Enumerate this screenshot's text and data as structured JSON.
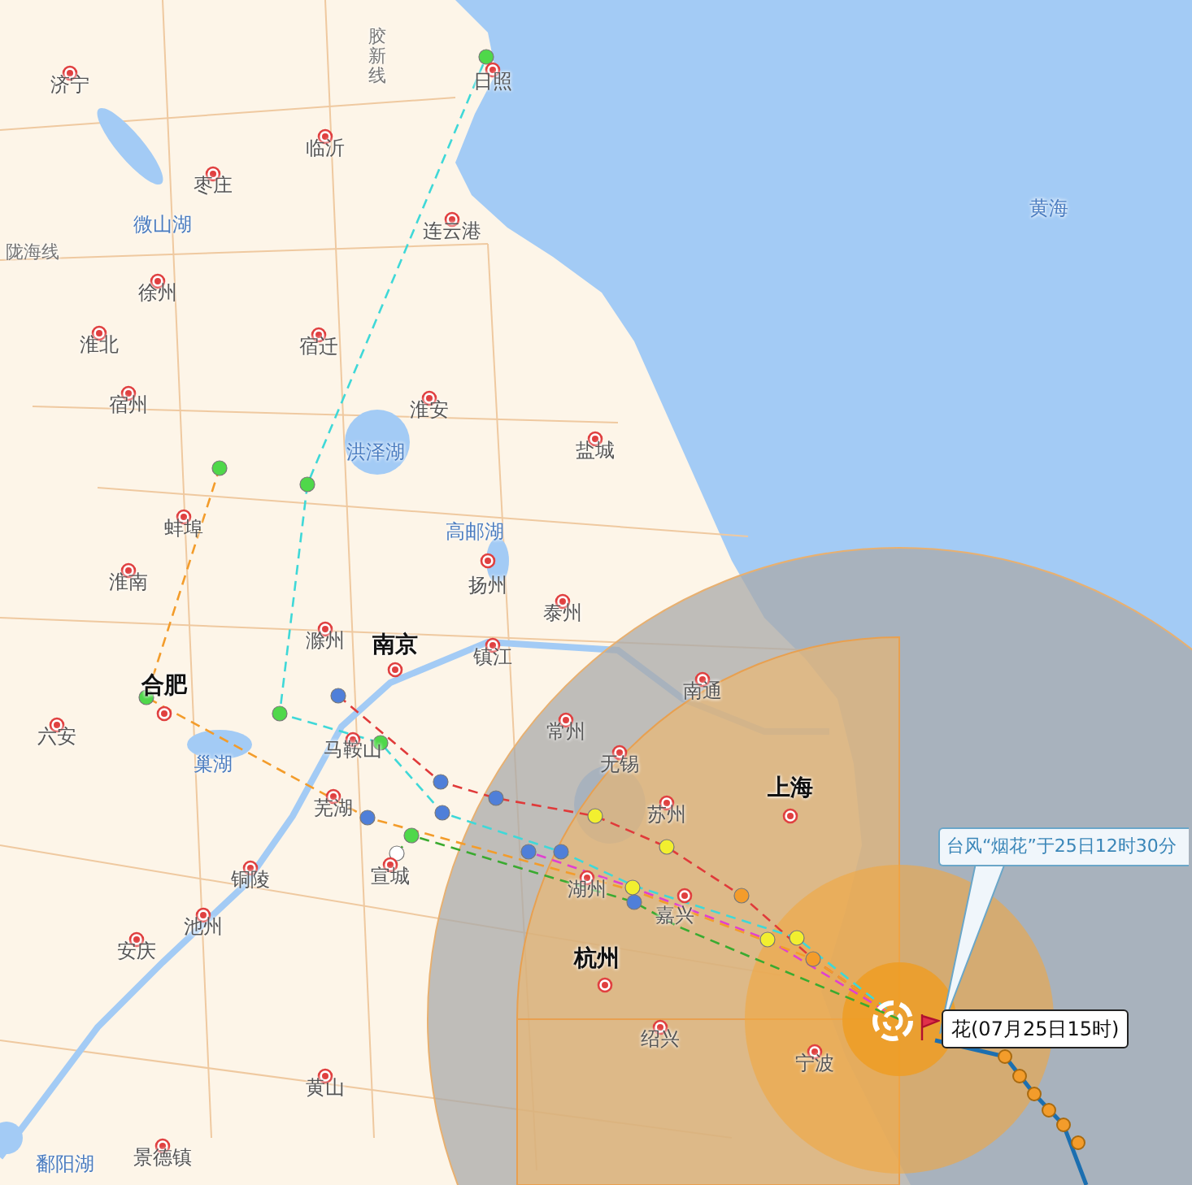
{
  "map": {
    "labels": [
      {
        "text": "济宁",
        "kind": "city"
      },
      {
        "text": "日照",
        "kind": "city"
      },
      {
        "text": "临沂",
        "kind": "city"
      },
      {
        "text": "枣庄",
        "kind": "city"
      },
      {
        "text": "微山湖",
        "kind": "water"
      },
      {
        "text": "陇海线",
        "kind": "rail"
      },
      {
        "text": "胶新线",
        "kind": "rail"
      },
      {
        "text": "连云港",
        "kind": "city"
      },
      {
        "text": "徐州",
        "kind": "city"
      },
      {
        "text": "淮北",
        "kind": "city"
      },
      {
        "text": "宿迁",
        "kind": "city"
      },
      {
        "text": "宿州",
        "kind": "city"
      },
      {
        "text": "淮安",
        "kind": "city"
      },
      {
        "text": "洪泽湖",
        "kind": "water"
      },
      {
        "text": "盐城",
        "kind": "city"
      },
      {
        "text": "蚌埠",
        "kind": "city"
      },
      {
        "text": "高邮湖",
        "kind": "water"
      },
      {
        "text": "淮南",
        "kind": "city"
      },
      {
        "text": "扬州",
        "kind": "city"
      },
      {
        "text": "泰州",
        "kind": "city"
      },
      {
        "text": "滁州",
        "kind": "city"
      },
      {
        "text": "南京",
        "kind": "capital"
      },
      {
        "text": "镇江",
        "kind": "city"
      },
      {
        "text": "合肥",
        "kind": "capital"
      },
      {
        "text": "六安",
        "kind": "city"
      },
      {
        "text": "巢湖",
        "kind": "water"
      },
      {
        "text": "马鞍山",
        "kind": "city"
      },
      {
        "text": "常州",
        "kind": "city"
      },
      {
        "text": "南通",
        "kind": "city"
      },
      {
        "text": "无锡",
        "kind": "city"
      },
      {
        "text": "上海",
        "kind": "capital"
      },
      {
        "text": "苏州",
        "kind": "city"
      },
      {
        "text": "芜湖",
        "kind": "city"
      },
      {
        "text": "宣城",
        "kind": "city"
      },
      {
        "text": "铜陵",
        "kind": "city"
      },
      {
        "text": "湖州",
        "kind": "city"
      },
      {
        "text": "嘉兴",
        "kind": "city"
      },
      {
        "text": "池州",
        "kind": "city"
      },
      {
        "text": "安庆",
        "kind": "city"
      },
      {
        "text": "杭州",
        "kind": "capital"
      },
      {
        "text": "绍兴",
        "kind": "city"
      },
      {
        "text": "宁波",
        "kind": "city"
      },
      {
        "text": "黄山",
        "kind": "city"
      },
      {
        "text": "鄱阳湖",
        "kind": "water"
      },
      {
        "text": "景德镇",
        "kind": "city"
      },
      {
        "text": "黄海",
        "kind": "water"
      }
    ],
    "tracks": [
      {
        "color": "#e03a3a",
        "points": [
          {
            "color": "#f39c2b"
          },
          {
            "color": "#f2ef2f"
          },
          {
            "color": "#f2ef2f"
          },
          {
            "color": "#4f7fd9"
          },
          {
            "color": "#4f7fd9"
          },
          {
            "color": "#4f7fd9"
          }
        ]
      },
      {
        "color": "#3fd8d8",
        "points": [
          {
            "color": "#f2ef2f"
          },
          {
            "color": "#4f7fd9"
          },
          {
            "color": "#4f7fd9"
          },
          {
            "color": "#4fd84a"
          },
          {
            "color": "#4fd84a"
          },
          {
            "color": "#4fd84a"
          },
          {
            "color": "#4fd84a"
          }
        ]
      },
      {
        "color": "#e040d0",
        "points": [
          {
            "color": "#f2ef2f"
          },
          {
            "color": "#f2ef2f"
          },
          {
            "color": "#4f7fd9"
          }
        ]
      },
      {
        "color": "#f39c2b",
        "points": [
          {
            "color": "#f39c2b"
          },
          {
            "color": "#4f7fd9"
          },
          {
            "color": "#4fd84a"
          },
          {
            "color": "#4fd84a"
          }
        ]
      },
      {
        "color": "#3aaa30",
        "points": [
          {
            "color": "#4f7fd9"
          },
          {
            "color": "#4fd84a"
          },
          {
            "color": "#ffffff"
          }
        ]
      }
    ],
    "callout": "台风“烟花”于25日12时30分",
    "marker_label": "花(07月25日15时)"
  }
}
